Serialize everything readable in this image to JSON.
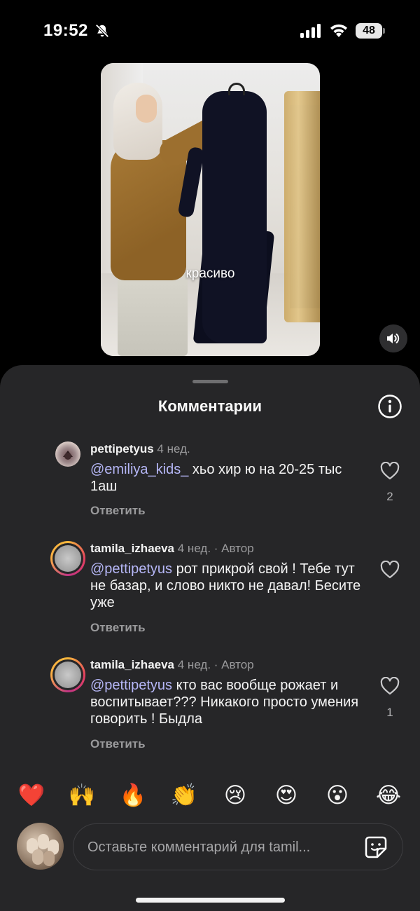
{
  "status_bar": {
    "time": "19:52",
    "battery": "48",
    "icons": [
      "bell-slash-icon",
      "signal-icon",
      "wifi-icon",
      "battery-icon"
    ]
  },
  "video": {
    "caption": "красиво",
    "sound_icon": "speaker-icon"
  },
  "comments_sheet": {
    "title": "Комментарии",
    "info_icon": "info-icon",
    "comments": [
      {
        "username": "pettipetyus",
        "time": "4 нед.",
        "author_badge": "",
        "mention": "@emiliya_kids_",
        "text": " хьо хир ю на 20-25 тыс 1аш",
        "reply_label": "Ответить",
        "likes": "2"
      },
      {
        "username": "tamila_izhaeva",
        "time": "4 нед.",
        "author_badge": "· Автор",
        "mention": "@pettipetyus",
        "text": " рот прикрой свой ! Тебе тут не базар, и слово никто не давал! Бесите уже",
        "reply_label": "Ответить",
        "likes": ""
      },
      {
        "username": "tamila_izhaeva",
        "time": "4 нед.",
        "author_badge": "· Автор",
        "mention": "@pettipetyus",
        "text": " кто вас вообще рожает и воспитывает??? Никакого просто умения говорить ! Быдла",
        "reply_label": "Ответить",
        "likes": "1"
      }
    ]
  },
  "emoji_reactions": [
    "❤️",
    "🙌",
    "🔥",
    "👏",
    "😢",
    "😍",
    "😮",
    "😂"
  ],
  "composer": {
    "placeholder": "Оставьте комментарий для tamil...",
    "sticker_icon": "sticker-icon"
  },
  "colors": {
    "sheet_background": "#262628",
    "mention": "#b6b7f7",
    "muted_text": "#9a9a9c"
  }
}
